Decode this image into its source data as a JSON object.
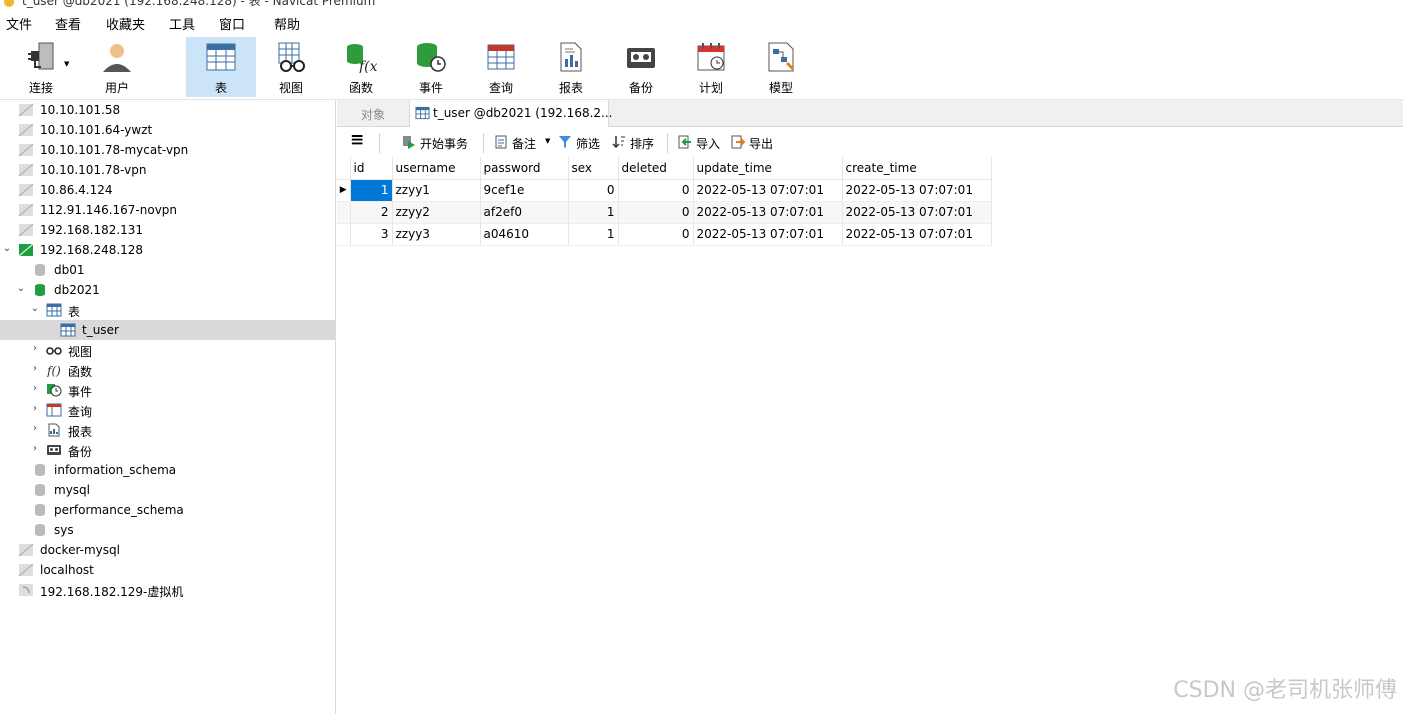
{
  "window": {
    "title": "t_user @db2021 (192.168.248.128) - 表 - Navicat Premium"
  },
  "menu": [
    "文件",
    "查看",
    "收藏夹",
    "工具",
    "窗口",
    "帮助"
  ],
  "toolbar": [
    {
      "label": "连接",
      "icon": "plug-icon"
    },
    {
      "label": "用户",
      "icon": "user-icon"
    },
    {
      "label": "表",
      "icon": "table-icon"
    },
    {
      "label": "视图",
      "icon": "glasses-icon"
    },
    {
      "label": "函数",
      "icon": "function-icon"
    },
    {
      "label": "事件",
      "icon": "clock-icon"
    },
    {
      "label": "查询",
      "icon": "query-icon"
    },
    {
      "label": "报表",
      "icon": "report-icon"
    },
    {
      "label": "备份",
      "icon": "tape-icon"
    },
    {
      "label": "计划",
      "icon": "calendar-icon"
    },
    {
      "label": "模型",
      "icon": "model-icon"
    }
  ],
  "tree": [
    {
      "label": "10.10.101.58"
    },
    {
      "label": "10.10.101.64-ywzt"
    },
    {
      "label": "10.10.101.78-mycat-vpn"
    },
    {
      "label": "10.10.101.78-vpn"
    },
    {
      "label": "10.86.4.124"
    },
    {
      "label": "112.91.146.167-novpn"
    },
    {
      "label": "192.168.182.131"
    },
    {
      "label": "192.168.248.128"
    },
    {
      "label": "db01"
    },
    {
      "label": "db2021"
    },
    {
      "label": "表"
    },
    {
      "label": "t_user"
    },
    {
      "label": "视图"
    },
    {
      "label": "函数"
    },
    {
      "label": "事件"
    },
    {
      "label": "查询"
    },
    {
      "label": "报表"
    },
    {
      "label": "备份"
    },
    {
      "label": "information_schema"
    },
    {
      "label": "mysql"
    },
    {
      "label": "performance_schema"
    },
    {
      "label": "sys"
    },
    {
      "label": "docker-mysql"
    },
    {
      "label": "localhost"
    },
    {
      "label": "192.168.182.129-虚拟机"
    }
  ],
  "tabs": {
    "objects": "对象",
    "active": "t_user @db2021 (192.168.2..."
  },
  "actions": {
    "menu": "≡",
    "begin": "开始事务",
    "note": "备注",
    "filter": "筛选",
    "sort": "排序",
    "import": "导入",
    "export": "导出"
  },
  "table": {
    "columns": [
      "id",
      "username",
      "password",
      "sex",
      "deleted",
      "update_time",
      "create_time"
    ],
    "rows": [
      [
        "1",
        "zzyy1",
        "9cef1e",
        "0",
        "0",
        "2022-05-13 07:07:01",
        "2022-05-13 07:07:01"
      ],
      [
        "2",
        "zzyy2",
        "af2ef0",
        "1",
        "0",
        "2022-05-13 07:07:01",
        "2022-05-13 07:07:01"
      ],
      [
        "3",
        "zzyy3",
        "a04610",
        "1",
        "0",
        "2022-05-13 07:07:01",
        "2022-05-13 07:07:01"
      ]
    ]
  },
  "watermark": "CSDN @老司机张师傅",
  "colors": {
    "selection": "#0078d7",
    "active_tool": "#cce4f7",
    "tree_selected": "#d9d9d9",
    "mysql_green": "#1e9e3e"
  }
}
